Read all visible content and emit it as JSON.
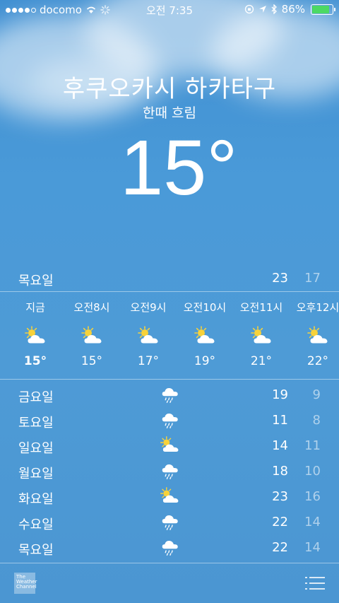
{
  "status": {
    "carrier": "docomo",
    "time": "오전 7:35",
    "battery": "86%",
    "battery_level": 0.86,
    "signal_bars": 4,
    "signal_total": 5
  },
  "location": {
    "city": "후쿠오카시 하카타구",
    "condition": "한때 흐림",
    "temperature": "15°"
  },
  "today": {
    "day": "목요일",
    "high": "23",
    "low": "17"
  },
  "hourly": [
    {
      "time": "지금",
      "temp": "15°",
      "icon": "partly-sunny-icon"
    },
    {
      "time": "오전8시",
      "temp": "15°",
      "icon": "partly-sunny-icon"
    },
    {
      "time": "오전9시",
      "temp": "17°",
      "icon": "partly-sunny-icon"
    },
    {
      "time": "오전10시",
      "temp": "19°",
      "icon": "partly-sunny-icon"
    },
    {
      "time": "오전11시",
      "temp": "21°",
      "icon": "partly-sunny-icon"
    },
    {
      "time": "오후12시",
      "temp": "22°",
      "icon": "partly-sunny-icon"
    }
  ],
  "daily": [
    {
      "day": "금요일",
      "high": "19",
      "low": "9",
      "icon": "rain-icon"
    },
    {
      "day": "토요일",
      "high": "11",
      "low": "8",
      "icon": "rain-icon"
    },
    {
      "day": "일요일",
      "high": "14",
      "low": "11",
      "icon": "partly-sunny-icon"
    },
    {
      "day": "월요일",
      "high": "18",
      "low": "10",
      "icon": "rain-icon"
    },
    {
      "day": "화요일",
      "high": "23",
      "low": "16",
      "icon": "partly-sunny-icon"
    },
    {
      "day": "수요일",
      "high": "22",
      "low": "14",
      "icon": "rain-icon"
    },
    {
      "day": "목요일",
      "high": "22",
      "low": "14",
      "icon": "rain-icon"
    }
  ],
  "footer": {
    "logo_text": "The Weather Channel"
  },
  "colors": {
    "battery": "#4cd964",
    "sun": "#f7d23a"
  }
}
